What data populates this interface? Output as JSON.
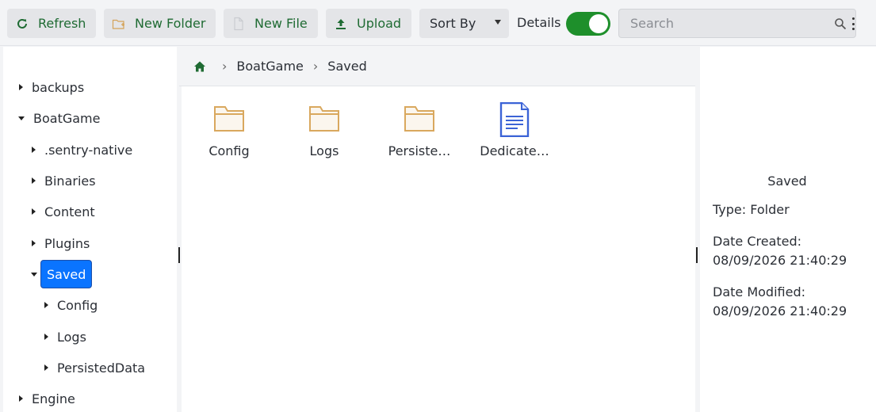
{
  "toolbar": {
    "refresh_label": "Refresh",
    "new_folder_label": "New Folder",
    "new_file_label": "New File",
    "upload_label": "Upload",
    "sort_label": "Sort By",
    "details_label": "Details",
    "details_enabled": true,
    "search_placeholder": "Search",
    "accent_color": "#1e8f2b"
  },
  "tree": {
    "backups": "backups",
    "boatgame": "BoatGame",
    "sentry": ".sentry-native",
    "binaries": "Binaries",
    "content": "Content",
    "plugins": "Plugins",
    "saved": "Saved",
    "config": "Config",
    "logs": "Logs",
    "persisted": "PersistedData",
    "engine": "Engine",
    "selected_color": "#0a74ff"
  },
  "breadcrumb": {
    "home_icon": "home-icon",
    "items": [
      "BoatGame",
      "Saved"
    ],
    "separator": "›"
  },
  "files": [
    {
      "name": "Config",
      "type": "folder"
    },
    {
      "name": "Logs",
      "type": "folder"
    },
    {
      "name": "Persiste…",
      "type": "folder"
    },
    {
      "name": "Dedicate…",
      "type": "file"
    }
  ],
  "details": {
    "title": "Saved",
    "type": "Type: Folder",
    "created_label": "Date Created:",
    "created_value": "08/09/2026 21:40:29",
    "modified_label": "Date Modified:",
    "modified_value": "08/09/2026 21:40:29"
  }
}
